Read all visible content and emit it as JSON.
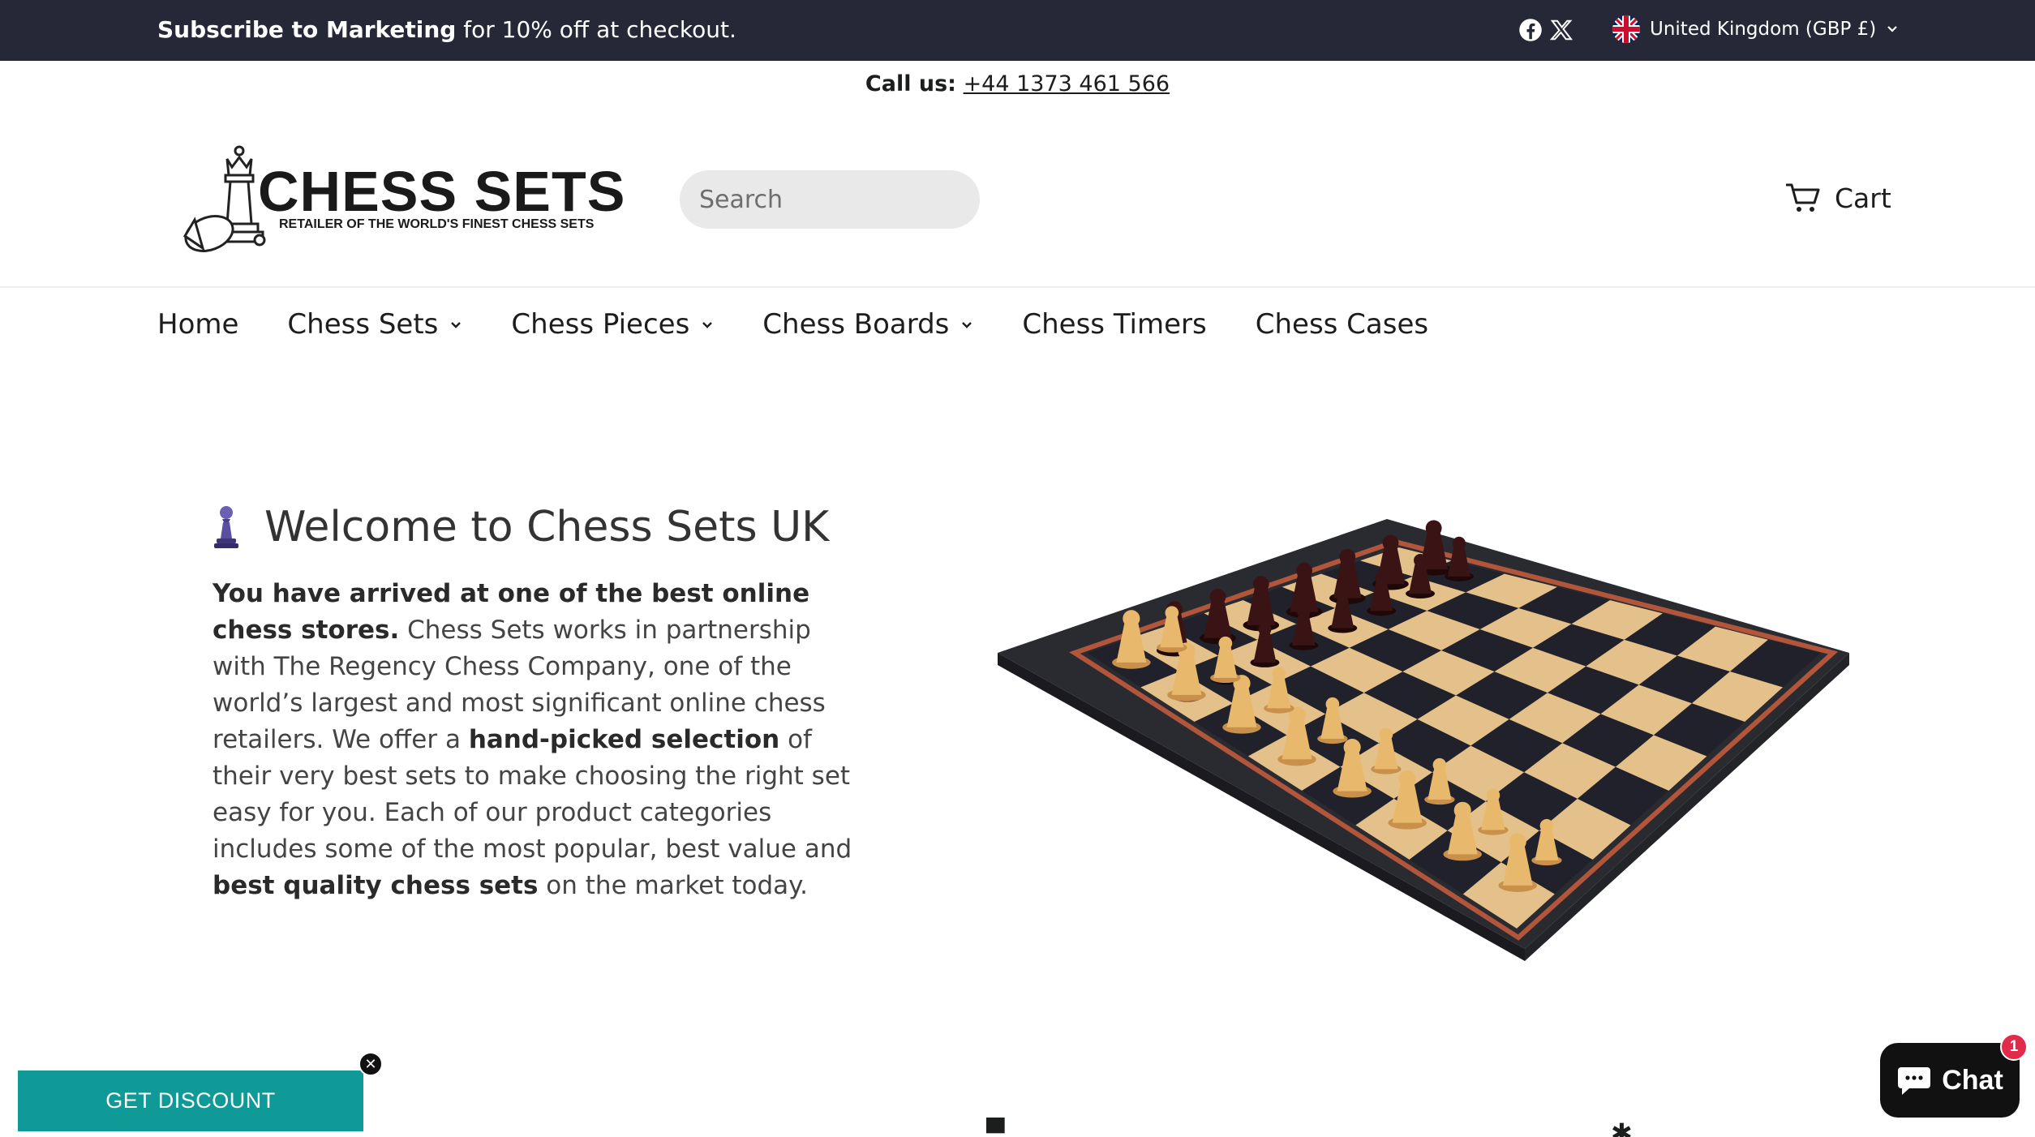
{
  "announcement": {
    "bold": "Subscribe to Marketing",
    "text": " for 10% off at checkout."
  },
  "social": {
    "icons": [
      "facebook-icon",
      "x-twitter-icon"
    ]
  },
  "currency": {
    "label": "United Kingdom (GBP £)"
  },
  "call": {
    "label": "Call us:",
    "phone": "+44 1373 461 566"
  },
  "logo": {
    "title": "CHESS SETS",
    "tagline": "RETAILER OF THE WORLD'S FINEST CHESS SETS"
  },
  "search": {
    "placeholder": "Search"
  },
  "cart": {
    "label": "Cart"
  },
  "nav": {
    "items": [
      {
        "label": "Home",
        "has_dropdown": false
      },
      {
        "label": "Chess Sets",
        "has_dropdown": true
      },
      {
        "label": "Chess Pieces",
        "has_dropdown": true
      },
      {
        "label": "Chess Boards",
        "has_dropdown": true
      },
      {
        "label": "Chess Timers",
        "has_dropdown": false
      },
      {
        "label": "Chess Cases",
        "has_dropdown": false
      }
    ]
  },
  "hero": {
    "title": "Welcome to Chess Sets UK",
    "p1_bold": "You have arrived at one of the best online chess stores.",
    "p1_text": " Chess Sets works in partnership with The Regency Chess Company, one of the world’s largest and most significant online chess retailers. We offer a ",
    "p2_bold": "hand-picked selection",
    "p2_text": " of their very best sets to make choosing the right set easy for you. Each of our product categories includes some of the most popular, best value and ",
    "p3_bold": "best quality chess sets",
    "p3_text": " on the market today."
  },
  "discount": {
    "label": "GET DISCOUNT",
    "close": "✕"
  },
  "chat": {
    "label": "Chat",
    "badge": "1"
  },
  "colors": {
    "topbar": "#262837",
    "discount": "#0f9a97",
    "chat": "#111111",
    "badge": "#e22a4b",
    "pawn": "#4b3f8a"
  }
}
